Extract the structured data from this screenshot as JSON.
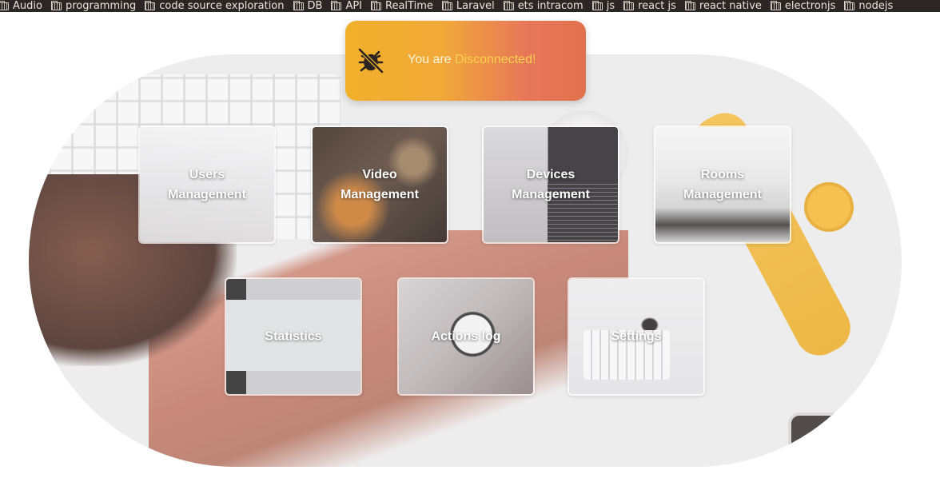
{
  "bookmarks": [
    {
      "label": "Audio"
    },
    {
      "label": "programming"
    },
    {
      "label": "code source exploration"
    },
    {
      "label": "DB"
    },
    {
      "label": "API"
    },
    {
      "label": "RealTime"
    },
    {
      "label": "Laravel"
    },
    {
      "label": "ets intracom"
    },
    {
      "label": "js"
    },
    {
      "label": "react js"
    },
    {
      "label": "react native"
    },
    {
      "label": "electronjs"
    },
    {
      "label": "nodejs"
    }
  ],
  "toast": {
    "prefix": "You are ",
    "status": "Disconnected!",
    "icon": "bug-off-icon"
  },
  "tiles": [
    {
      "id": "users",
      "label": "Users Management"
    },
    {
      "id": "video",
      "label": "Video Management"
    },
    {
      "id": "devices",
      "label": "Devices Management"
    },
    {
      "id": "rooms",
      "label": "Rooms Management"
    },
    {
      "id": "stats",
      "label": "Statistics"
    },
    {
      "id": "actions",
      "label": "Actions log"
    },
    {
      "id": "settings",
      "label": "Settings"
    }
  ],
  "colors": {
    "toast_start": "#f1b02b",
    "toast_end": "#e2714e",
    "status_highlight": "#f7d34b",
    "bookmarks_bg": "#2b2523"
  }
}
